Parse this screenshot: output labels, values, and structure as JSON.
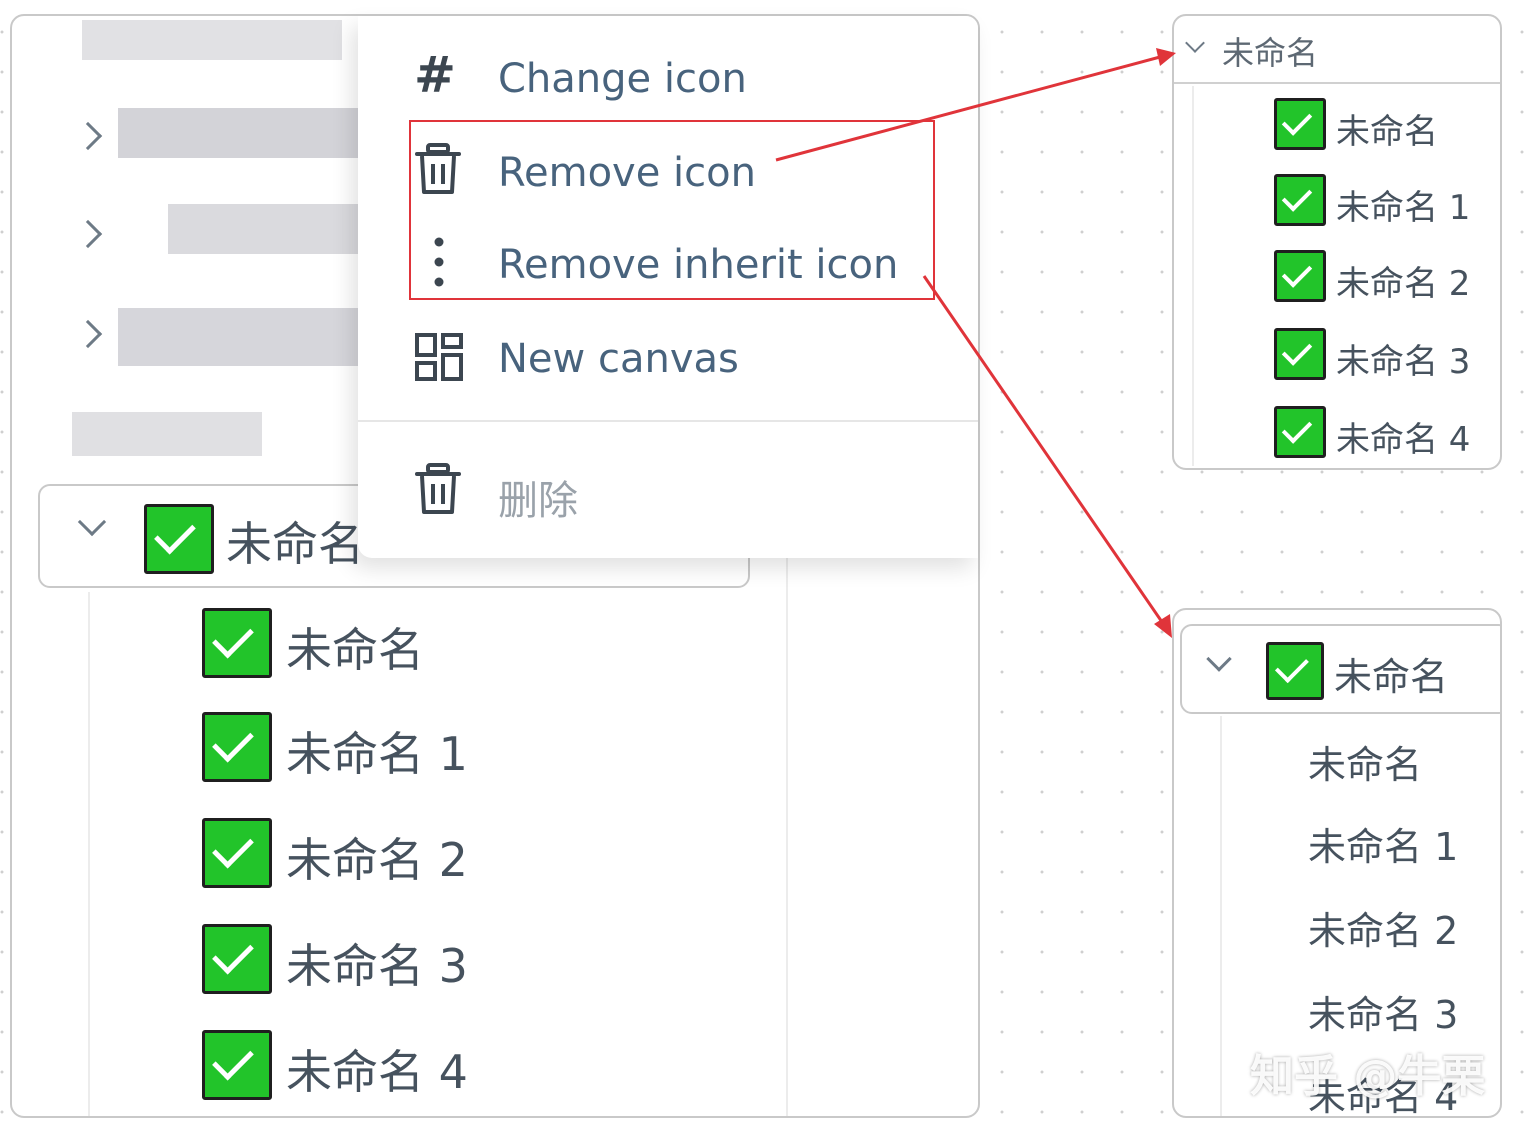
{
  "context_menu": {
    "items": [
      {
        "label": "Change icon",
        "icon": "hash-icon"
      },
      {
        "label": "Remove icon",
        "icon": "trash-icon"
      },
      {
        "label": "Remove inherit icon",
        "icon": "vertical-dots-icon"
      },
      {
        "label": "New canvas",
        "icon": "grid-icon"
      }
    ],
    "delete_label": "删除",
    "delete_icon": "trash-icon"
  },
  "main_tree": {
    "root_label": "未命名",
    "children": [
      "未命名",
      "未命名 1",
      "未命名 2",
      "未命名 3",
      "未命名 4"
    ]
  },
  "right_top_tree": {
    "root_label": "未命名",
    "children": [
      "未命名",
      "未命名 1",
      "未命名 2",
      "未命名 3",
      "未命名 4"
    ]
  },
  "right_bottom_tree": {
    "root_label": "未命名",
    "children": [
      "未命名",
      "未命名 1",
      "未命名 2",
      "未命名 3",
      "未命名 4"
    ]
  },
  "watermark": "知乎 @牛栗",
  "colors": {
    "check_green": "#22c42a",
    "highlight_red": "#e0343a",
    "menu_text": "#48637d"
  }
}
